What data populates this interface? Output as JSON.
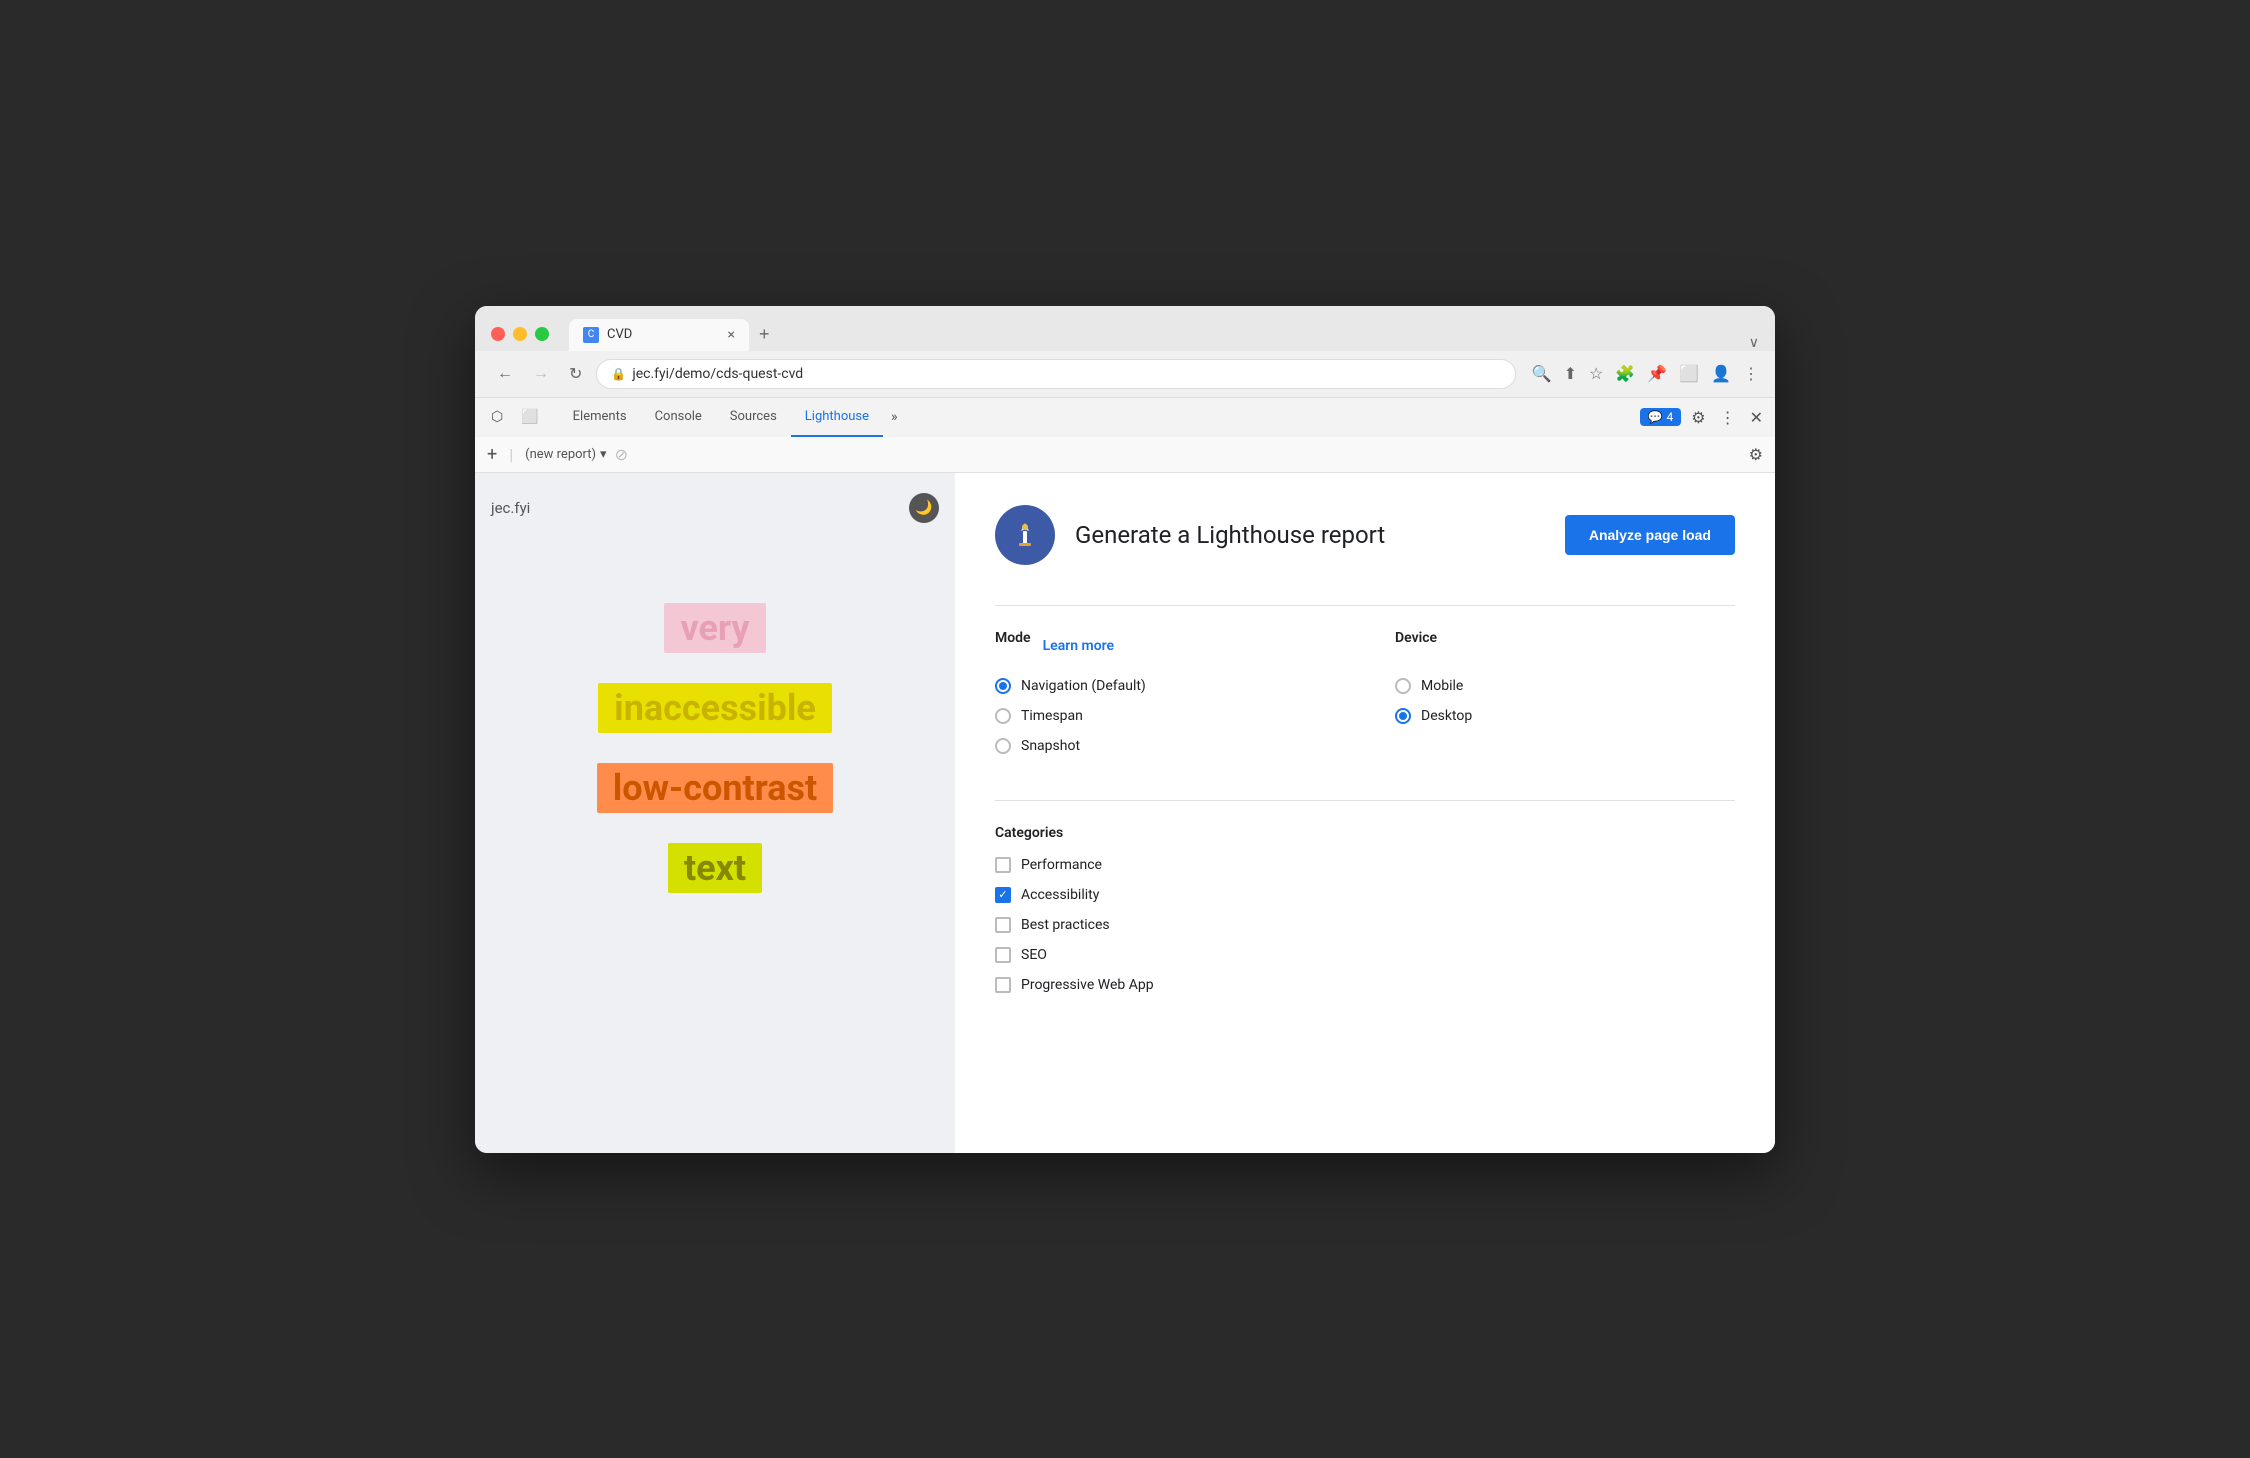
{
  "browser": {
    "traffic_lights": [
      "red",
      "yellow",
      "green"
    ],
    "tab": {
      "favicon_text": "C",
      "title": "CVD",
      "close_label": "×"
    },
    "new_tab_label": "+",
    "chevron_label": "∨",
    "nav": {
      "back_label": "←",
      "forward_label": "→",
      "reload_label": "↻"
    },
    "address": {
      "lock_icon": "🔒",
      "url": "jec.fyi/demo/cds-quest-cvd"
    },
    "address_icons": [
      "🔍",
      "⬆",
      "★",
      "🧩",
      "📌",
      "⬜",
      "👤",
      "⋮"
    ]
  },
  "devtools": {
    "tools": [
      "cursor-icon",
      "screen-icon"
    ],
    "tabs": [
      "Elements",
      "Console",
      "Sources",
      "Lighthouse"
    ],
    "active_tab": "Lighthouse",
    "more_label": "»",
    "badge": {
      "icon": "💬",
      "count": "4"
    },
    "actions": [
      "⚙",
      "⋮",
      "×"
    ],
    "toolbar": {
      "add_label": "+",
      "separator": "|",
      "report_placeholder": "(new report)",
      "dropdown_icon": "▾",
      "block_icon": "⊘",
      "settings_icon": "⚙"
    }
  },
  "website": {
    "logo": "jec.fyi",
    "theme_icon": "🌙",
    "words": [
      {
        "text": "very",
        "class": "word-very"
      },
      {
        "text": "inaccessible",
        "class": "word-inaccessible"
      },
      {
        "text": "low-contrast",
        "class": "word-low-contrast"
      },
      {
        "text": "text",
        "class": "word-text"
      }
    ]
  },
  "lighthouse_panel": {
    "icon_alt": "Lighthouse logo",
    "title": "Generate a Lighthouse report",
    "analyze_btn_label": "Analyze page load",
    "mode_section_label": "Mode",
    "learn_more_label": "Learn more",
    "modes": [
      {
        "label": "Navigation (Default)",
        "selected": true
      },
      {
        "label": "Timespan",
        "selected": false
      },
      {
        "label": "Snapshot",
        "selected": false
      }
    ],
    "device_section_label": "Device",
    "devices": [
      {
        "label": "Mobile",
        "selected": false
      },
      {
        "label": "Desktop",
        "selected": true
      }
    ],
    "categories_section_label": "Categories",
    "categories": [
      {
        "label": "Performance",
        "checked": false
      },
      {
        "label": "Accessibility",
        "checked": true
      },
      {
        "label": "Best practices",
        "checked": false
      },
      {
        "label": "SEO",
        "checked": false
      },
      {
        "label": "Progressive Web App",
        "checked": false
      }
    ]
  }
}
